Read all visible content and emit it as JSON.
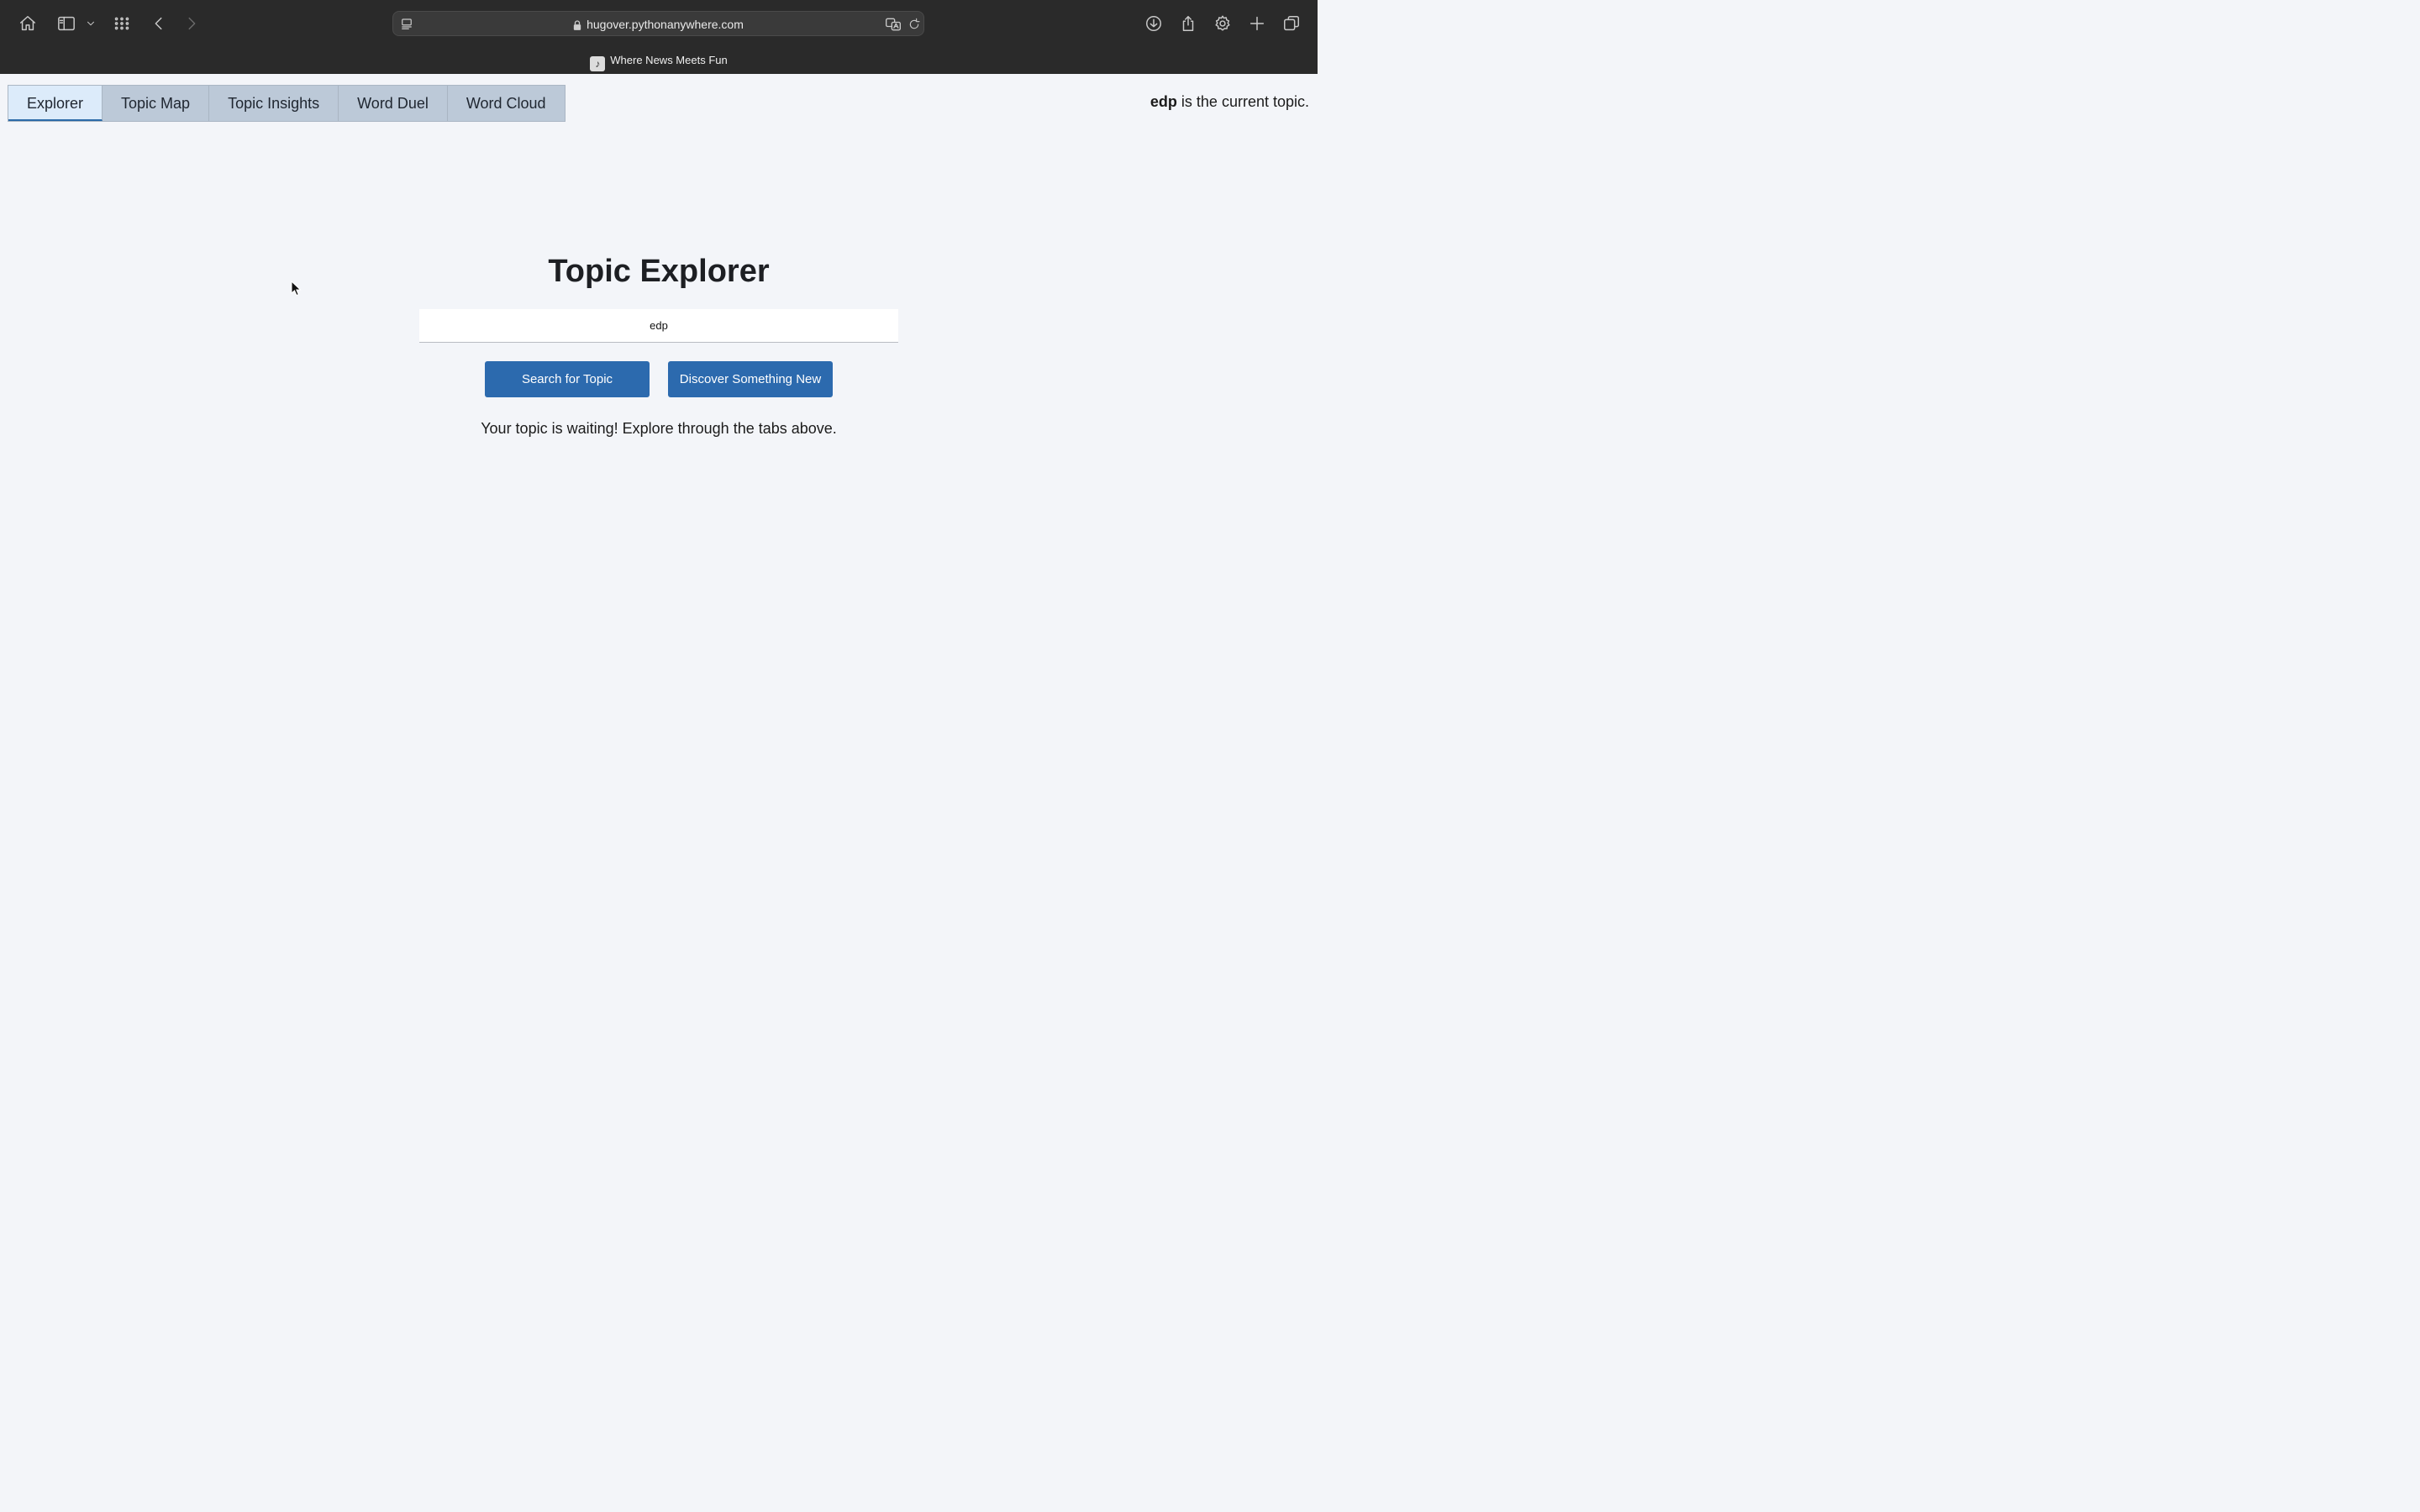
{
  "browser": {
    "url": "hugover.pythonanywhere.com",
    "tab_title": "Where News Meets Fun",
    "icons": [
      "home-icon",
      "sidebar-icon",
      "chevron-down-icon",
      "grid-icon",
      "back-icon",
      "forward-icon",
      "reader-icon",
      "translate-icon",
      "reload-icon",
      "download-icon",
      "share-icon",
      "settings-icon",
      "new-tab-icon",
      "tabs-overview-icon"
    ]
  },
  "nav": {
    "tabs": [
      {
        "label": "Explorer",
        "active": true
      },
      {
        "label": "Topic Map",
        "active": false
      },
      {
        "label": "Topic Insights",
        "active": false
      },
      {
        "label": "Word Duel",
        "active": false
      },
      {
        "label": "Word Cloud",
        "active": false
      }
    ],
    "current_topic_name": "edp",
    "current_topic_suffix": "is the current topic."
  },
  "main": {
    "title": "Topic Explorer",
    "search_value": "edp",
    "search_button": "Search for Topic",
    "discover_button": "Discover Something New",
    "message": "Your topic is waiting! Explore through the tabs above."
  },
  "colors": {
    "chrome_bg": "#2a2a2a",
    "page_bg": "#f3f5f9",
    "button_bg": "#2c6aae",
    "tab_bar_bg": "#bcc9d8",
    "active_tab_bg": "#dcebfa"
  }
}
